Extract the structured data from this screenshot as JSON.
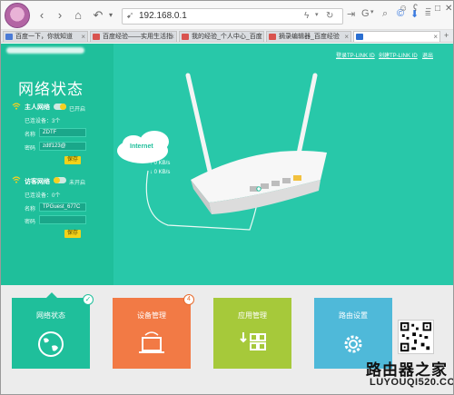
{
  "browser": {
    "url": "192.168.0.1",
    "tabs": [
      {
        "label": "百度一下，你就知道",
        "active": false
      },
      {
        "label": "百度经验——实用生活指",
        "active": false
      },
      {
        "label": "我的经验_个人中心_百度",
        "active": false
      },
      {
        "label": "摘录编辑器_百度经验",
        "active": false
      },
      {
        "label": "",
        "active": true
      }
    ]
  },
  "router": {
    "title": "网络状态",
    "links": {
      "login": "登录TP-LINK ID",
      "create": "创建TP-LINK ID",
      "exit": "退出"
    },
    "host_network": {
      "heading": "主人网络",
      "toggle_label": "已开启",
      "connected": "已连设备：3个",
      "name_label": "名称",
      "name_value": "ZDTF",
      "password_label": "密码",
      "password_value": "zdtf123@",
      "save": "保存"
    },
    "guest_network": {
      "heading": "访客网络",
      "toggle_label": "未开启",
      "connected": "已连设备：0个",
      "name_label": "名称",
      "name_value": "TPGuest_677C",
      "password_label": "密码",
      "password_value": "",
      "save": "保存"
    },
    "internet": {
      "label": "Internet",
      "up": "0 KB/s",
      "down": "0 KB/s"
    },
    "tiles": [
      {
        "label": "网络状态",
        "color": "#1fbf9b",
        "badge": "✓"
      },
      {
        "label": "设备管理",
        "color": "#f27a45",
        "badge": "4"
      },
      {
        "label": "应用管理",
        "color": "#a6c93a",
        "badge": ""
      },
      {
        "label": "路由设置",
        "color": "#4fb9d9",
        "badge": ""
      }
    ]
  },
  "watermark": {
    "line1": "路由器之家",
    "line2": "LUYOUQI520.COM"
  }
}
